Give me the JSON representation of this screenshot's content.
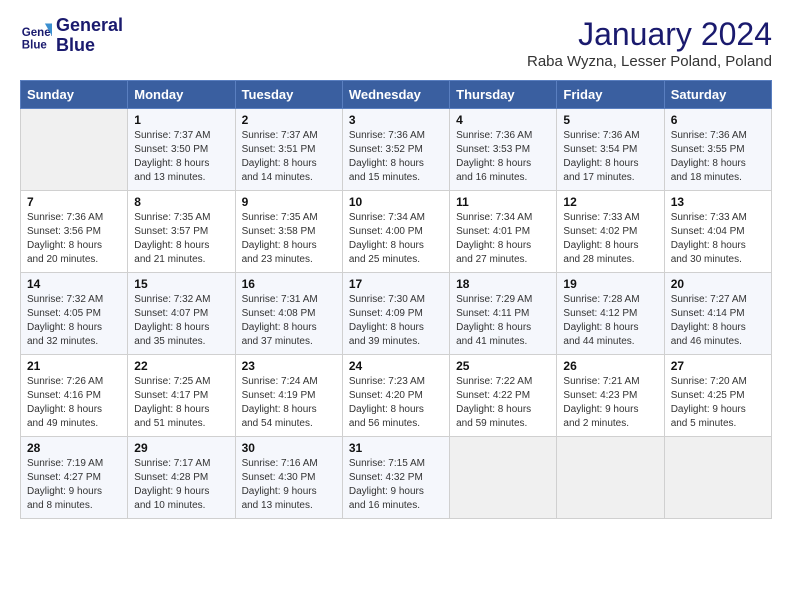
{
  "header": {
    "logo_line1": "General",
    "logo_line2": "Blue",
    "month_title": "January 2024",
    "location": "Raba Wyzna, Lesser Poland, Poland"
  },
  "weekdays": [
    "Sunday",
    "Monday",
    "Tuesday",
    "Wednesday",
    "Thursday",
    "Friday",
    "Saturday"
  ],
  "weeks": [
    [
      {
        "day": "",
        "sunrise": "",
        "sunset": "",
        "daylight": ""
      },
      {
        "day": "1",
        "sunrise": "Sunrise: 7:37 AM",
        "sunset": "Sunset: 3:50 PM",
        "daylight": "Daylight: 8 hours and 13 minutes."
      },
      {
        "day": "2",
        "sunrise": "Sunrise: 7:37 AM",
        "sunset": "Sunset: 3:51 PM",
        "daylight": "Daylight: 8 hours and 14 minutes."
      },
      {
        "day": "3",
        "sunrise": "Sunrise: 7:36 AM",
        "sunset": "Sunset: 3:52 PM",
        "daylight": "Daylight: 8 hours and 15 minutes."
      },
      {
        "day": "4",
        "sunrise": "Sunrise: 7:36 AM",
        "sunset": "Sunset: 3:53 PM",
        "daylight": "Daylight: 8 hours and 16 minutes."
      },
      {
        "day": "5",
        "sunrise": "Sunrise: 7:36 AM",
        "sunset": "Sunset: 3:54 PM",
        "daylight": "Daylight: 8 hours and 17 minutes."
      },
      {
        "day": "6",
        "sunrise": "Sunrise: 7:36 AM",
        "sunset": "Sunset: 3:55 PM",
        "daylight": "Daylight: 8 hours and 18 minutes."
      }
    ],
    [
      {
        "day": "7",
        "sunrise": "Sunrise: 7:36 AM",
        "sunset": "Sunset: 3:56 PM",
        "daylight": "Daylight: 8 hours and 20 minutes."
      },
      {
        "day": "8",
        "sunrise": "Sunrise: 7:35 AM",
        "sunset": "Sunset: 3:57 PM",
        "daylight": "Daylight: 8 hours and 21 minutes."
      },
      {
        "day": "9",
        "sunrise": "Sunrise: 7:35 AM",
        "sunset": "Sunset: 3:58 PM",
        "daylight": "Daylight: 8 hours and 23 minutes."
      },
      {
        "day": "10",
        "sunrise": "Sunrise: 7:34 AM",
        "sunset": "Sunset: 4:00 PM",
        "daylight": "Daylight: 8 hours and 25 minutes."
      },
      {
        "day": "11",
        "sunrise": "Sunrise: 7:34 AM",
        "sunset": "Sunset: 4:01 PM",
        "daylight": "Daylight: 8 hours and 27 minutes."
      },
      {
        "day": "12",
        "sunrise": "Sunrise: 7:33 AM",
        "sunset": "Sunset: 4:02 PM",
        "daylight": "Daylight: 8 hours and 28 minutes."
      },
      {
        "day": "13",
        "sunrise": "Sunrise: 7:33 AM",
        "sunset": "Sunset: 4:04 PM",
        "daylight": "Daylight: 8 hours and 30 minutes."
      }
    ],
    [
      {
        "day": "14",
        "sunrise": "Sunrise: 7:32 AM",
        "sunset": "Sunset: 4:05 PM",
        "daylight": "Daylight: 8 hours and 32 minutes."
      },
      {
        "day": "15",
        "sunrise": "Sunrise: 7:32 AM",
        "sunset": "Sunset: 4:07 PM",
        "daylight": "Daylight: 8 hours and 35 minutes."
      },
      {
        "day": "16",
        "sunrise": "Sunrise: 7:31 AM",
        "sunset": "Sunset: 4:08 PM",
        "daylight": "Daylight: 8 hours and 37 minutes."
      },
      {
        "day": "17",
        "sunrise": "Sunrise: 7:30 AM",
        "sunset": "Sunset: 4:09 PM",
        "daylight": "Daylight: 8 hours and 39 minutes."
      },
      {
        "day": "18",
        "sunrise": "Sunrise: 7:29 AM",
        "sunset": "Sunset: 4:11 PM",
        "daylight": "Daylight: 8 hours and 41 minutes."
      },
      {
        "day": "19",
        "sunrise": "Sunrise: 7:28 AM",
        "sunset": "Sunset: 4:12 PM",
        "daylight": "Daylight: 8 hours and 44 minutes."
      },
      {
        "day": "20",
        "sunrise": "Sunrise: 7:27 AM",
        "sunset": "Sunset: 4:14 PM",
        "daylight": "Daylight: 8 hours and 46 minutes."
      }
    ],
    [
      {
        "day": "21",
        "sunrise": "Sunrise: 7:26 AM",
        "sunset": "Sunset: 4:16 PM",
        "daylight": "Daylight: 8 hours and 49 minutes."
      },
      {
        "day": "22",
        "sunrise": "Sunrise: 7:25 AM",
        "sunset": "Sunset: 4:17 PM",
        "daylight": "Daylight: 8 hours and 51 minutes."
      },
      {
        "day": "23",
        "sunrise": "Sunrise: 7:24 AM",
        "sunset": "Sunset: 4:19 PM",
        "daylight": "Daylight: 8 hours and 54 minutes."
      },
      {
        "day": "24",
        "sunrise": "Sunrise: 7:23 AM",
        "sunset": "Sunset: 4:20 PM",
        "daylight": "Daylight: 8 hours and 56 minutes."
      },
      {
        "day": "25",
        "sunrise": "Sunrise: 7:22 AM",
        "sunset": "Sunset: 4:22 PM",
        "daylight": "Daylight: 8 hours and 59 minutes."
      },
      {
        "day": "26",
        "sunrise": "Sunrise: 7:21 AM",
        "sunset": "Sunset: 4:23 PM",
        "daylight": "Daylight: 9 hours and 2 minutes."
      },
      {
        "day": "27",
        "sunrise": "Sunrise: 7:20 AM",
        "sunset": "Sunset: 4:25 PM",
        "daylight": "Daylight: 9 hours and 5 minutes."
      }
    ],
    [
      {
        "day": "28",
        "sunrise": "Sunrise: 7:19 AM",
        "sunset": "Sunset: 4:27 PM",
        "daylight": "Daylight: 9 hours and 8 minutes."
      },
      {
        "day": "29",
        "sunrise": "Sunrise: 7:17 AM",
        "sunset": "Sunset: 4:28 PM",
        "daylight": "Daylight: 9 hours and 10 minutes."
      },
      {
        "day": "30",
        "sunrise": "Sunrise: 7:16 AM",
        "sunset": "Sunset: 4:30 PM",
        "daylight": "Daylight: 9 hours and 13 minutes."
      },
      {
        "day": "31",
        "sunrise": "Sunrise: 7:15 AM",
        "sunset": "Sunset: 4:32 PM",
        "daylight": "Daylight: 9 hours and 16 minutes."
      },
      {
        "day": "",
        "sunrise": "",
        "sunset": "",
        "daylight": ""
      },
      {
        "day": "",
        "sunrise": "",
        "sunset": "",
        "daylight": ""
      },
      {
        "day": "",
        "sunrise": "",
        "sunset": "",
        "daylight": ""
      }
    ]
  ]
}
